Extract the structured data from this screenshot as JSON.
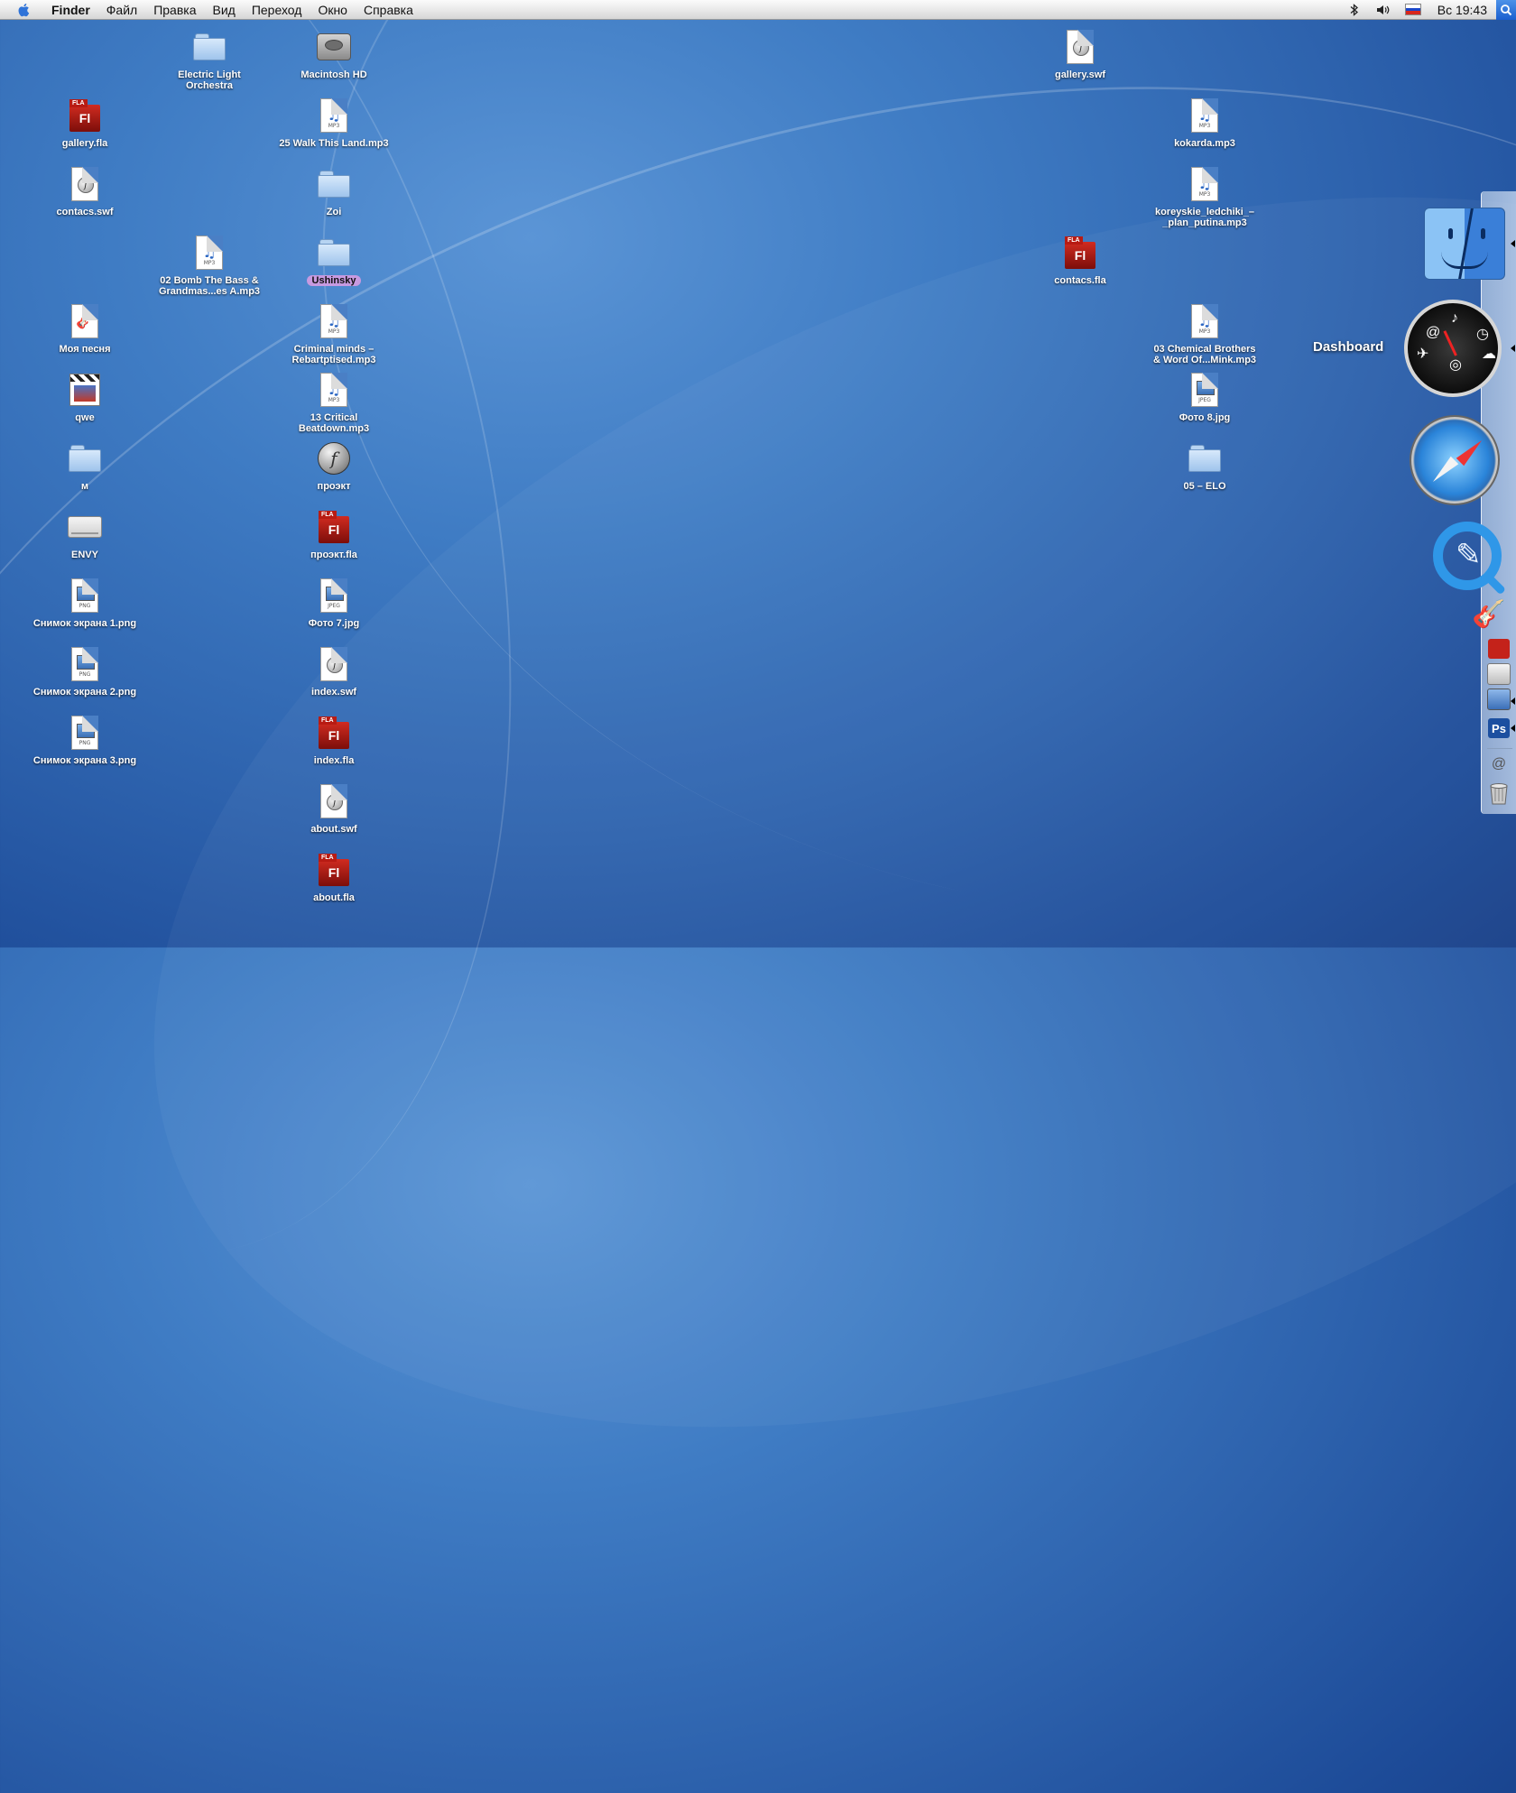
{
  "menubar": {
    "app_name": "Finder",
    "menus": [
      "Файл",
      "Правка",
      "Вид",
      "Переход",
      "Окно",
      "Справка"
    ],
    "clock": "Вс 19:43",
    "status_icons": [
      "bluetooth-icon",
      "volume-icon",
      "russian-flag-icon",
      "spotlight-icon"
    ]
  },
  "desktop": {
    "icons": [
      {
        "label": "Electric Light Orchestra",
        "type": "folder"
      },
      {
        "label": "Macintosh HD",
        "type": "hard-drive"
      },
      {
        "label": "gallery.swf",
        "type": "swf"
      },
      {
        "label": "gallery.fla",
        "type": "fla"
      },
      {
        "label": "25 Walk This Land.mp3",
        "type": "mp3"
      },
      {
        "label": "kokarda.mp3",
        "type": "mp3"
      },
      {
        "label": "contacs.swf",
        "type": "swf"
      },
      {
        "label": "Zoi",
        "type": "folder"
      },
      {
        "label": "koreyskie_ledchiki_–_plan_putina.mp3",
        "type": "mp3"
      },
      {
        "label": "02 Bomb The Bass & Grandmas...es A.mp3",
        "type": "mp3"
      },
      {
        "label": "Ushinsky",
        "type": "folder",
        "tag_color": "#c79ae0"
      },
      {
        "label": "contacs.fla",
        "type": "fla"
      },
      {
        "label": "Моя песня",
        "type": "garageband"
      },
      {
        "label": "Criminal minds – Rebartptised.mp3",
        "type": "mp3"
      },
      {
        "label": "03 Chemical Brothers & Word Of...Mink.mp3",
        "type": "mp3"
      },
      {
        "label": "qwe",
        "type": "movie"
      },
      {
        "label": "13 Critical Beatdown.mp3",
        "type": "mp3"
      },
      {
        "label": "Фото 8.jpg",
        "type": "jpeg"
      },
      {
        "label": "м",
        "type": "folder"
      },
      {
        "label": "проэкт",
        "type": "flash-app"
      },
      {
        "label": "05 – ELO",
        "type": "folder"
      },
      {
        "label": "ENVY",
        "type": "drive"
      },
      {
        "label": "проэкт.fla",
        "type": "fla"
      },
      {
        "label": "Снимок экрана 1.png",
        "type": "png"
      },
      {
        "label": "Фото 7.jpg",
        "type": "jpeg"
      },
      {
        "label": "Снимок экрана 2.png",
        "type": "png"
      },
      {
        "label": "index.swf",
        "type": "swf"
      },
      {
        "label": "Снимок экрана 3.png",
        "type": "png"
      },
      {
        "label": "index.fla",
        "type": "fla"
      },
      {
        "label": "about.swf",
        "type": "swf"
      },
      {
        "label": "about.fla",
        "type": "fla"
      }
    ]
  },
  "dock": {
    "tooltip": "Dashboard",
    "items": [
      "finder-icon",
      "dashboard-icon",
      "safari-icon",
      "quicktime-icon",
      "garageband-icon",
      "flash-icon",
      "preview-icon",
      "photo-icon",
      "photoshop-icon",
      "mail-icon",
      "trash-icon"
    ],
    "photoshop_label": "Ps"
  }
}
